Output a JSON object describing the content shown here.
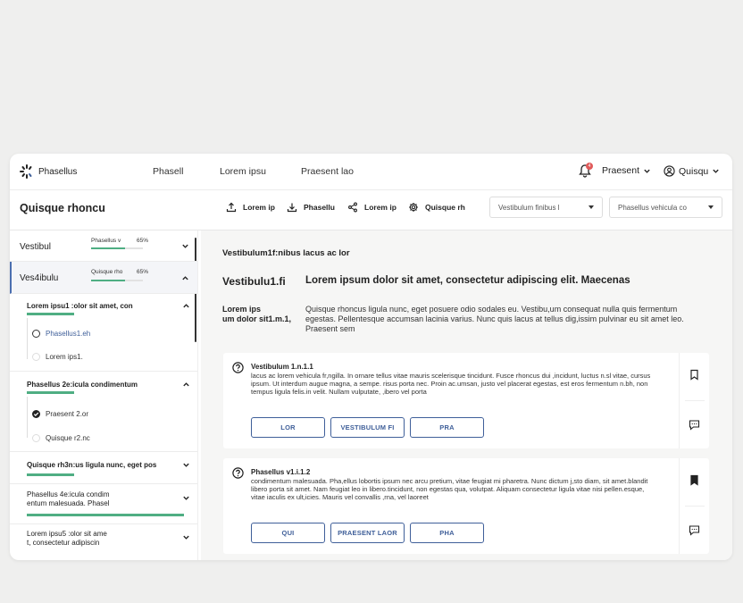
{
  "nav": {
    "brand": "Phasellus",
    "links": [
      "Phasell",
      "Lorem ipsu",
      "Praesent lao"
    ],
    "notification_count": "4",
    "dropdown1": "Praesent",
    "user": "Quisqu"
  },
  "toolbar": {
    "title": "Quisque rhoncu",
    "buttons": [
      "Lorem ip",
      "Phasellu",
      "Lorem ip",
      "Quisque rh"
    ],
    "select1": "Vestibulum finibus l",
    "select2": "Phasellus vehicula co"
  },
  "sidebar": {
    "sections": [
      {
        "title": "Vestibul",
        "mini": "Phasellus v",
        "pct_label": "65%",
        "progress": 0.65
      },
      {
        "title": "Ves4ibulu",
        "mini": "Quisque rho",
        "pct_label": "65%",
        "progress": 0.65
      }
    ],
    "subsections": [
      {
        "title": "Lorem ipsu1 :olor sit amet, con",
        "progress": 0.3
      },
      {
        "title": "Phasellus 2e:icula condimentum",
        "progress": 0.3
      },
      {
        "title": "Quisque rh3n:us ligula nunc, eget pos",
        "progress": 0.3
      },
      {
        "title_line1": "Phasellus 4e:icula condim",
        "title_line2": "entum malesuada. Phasel",
        "progress": 1.0
      },
      {
        "title_line1": "Lorem ipsu5 :olor sit ame",
        "title_line2": "t, consectetur adipiscin"
      }
    ],
    "options1": [
      "Phasellus1.eh",
      "Lorem ips1."
    ],
    "options2": [
      "Praesent 2.or",
      "Quisque r2.nc"
    ]
  },
  "main": {
    "heading": "Vestibulum1f:nibus lacus ac lor",
    "big_left": "Vestibulu1.fi",
    "big_right": "Lorem ipsum dolor sit amet, consectetur adipiscing elit. Maecenas",
    "side_line1": "Lorem ips",
    "side_line2": "um dolor sit1.m.1,",
    "description": "Quisque rhoncus ligula nunc, eget posuere odio sodales eu. Vestibu,um consequat nulla quis fermentum egestas. Pellentesque accumsan lacinia varius. Nunc quis lacus at tellus dig,issim pulvinar eu sit amet leo. Praesent sem",
    "questions": [
      {
        "title": "Vestibulum 1.n.1.1",
        "body": " lacus ac lorem vehicula fr,ngilla. In ornare tellus vitae mauris scelerisque tincidunt. Fusce rhoncus dui ,incidunt, luctus n.sl vitae, cursus ipsum. Ut interdum augue magna, a sempe. risus porta nec. Proin ac.umsan, justo vel placerat egestas, est eros fermentum n.bh, non tempus ligula felis.in velit. Nullam vulputate, ,ibero vel porta",
        "options": [
          "LOR",
          "VESTIBULUM FI",
          "PRA"
        ]
      },
      {
        "title": "Phasellus v1.i.1.2",
        "body": " condimentum malesuada. Pha,ellus lobortis ipsum nec arcu pretium, vitae feugiat mi pharetra. Nunc dictum j,sto diam, sit amet.blandit libero porta sit amet. Nam feugiat leo in libero.tincidunt, non egestas qua, volutpat. Aliquam consectetur ligula vitae nisi pellen.esque, vitae iaculis ex ult,icies. Mauris vel convallis ,rna, vel laoreet",
        "options": [
          "QUI",
          "PRAESENT LAOR",
          "PHA"
        ]
      }
    ]
  },
  "colors": {
    "accent": "#3f5f99",
    "progress": "#4fae83",
    "badge": "#e05a5a"
  }
}
